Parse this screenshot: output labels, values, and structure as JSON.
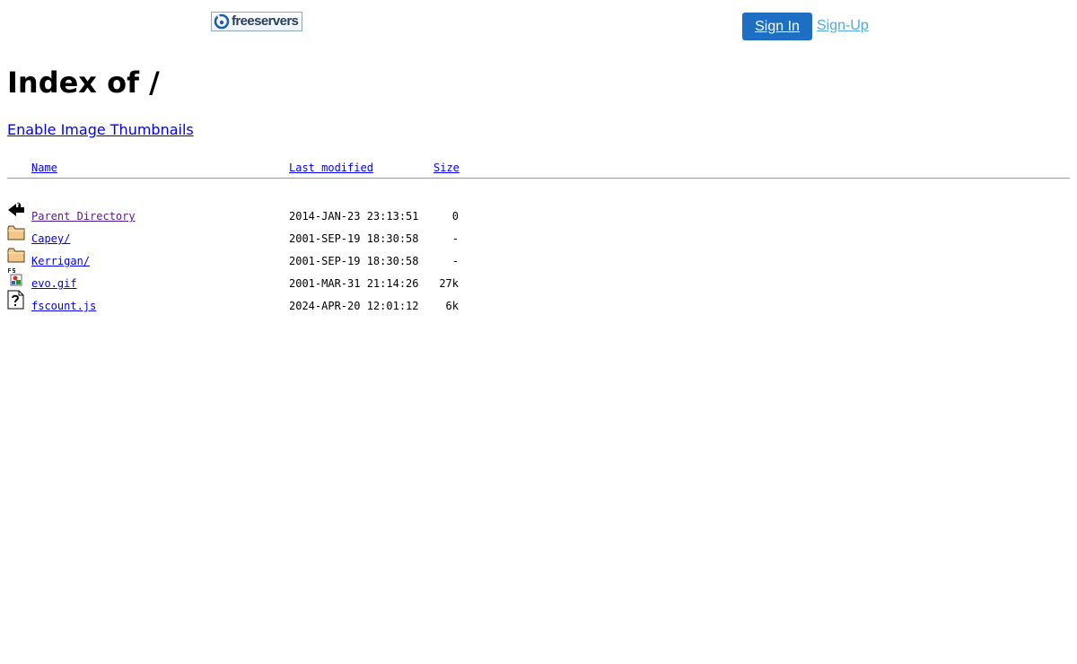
{
  "header": {
    "logo_text": "freeservers",
    "sign_in_label": "Sign In",
    "sign_up_label": "Sign-Up"
  },
  "page": {
    "title": "Index of /",
    "thumbnail_link": "Enable Image Thumbnails"
  },
  "columns": {
    "name": "Name",
    "last_modified": "Last modified",
    "size": "Size"
  },
  "entries": [
    {
      "icon": "back-arrow-icon",
      "name": "Parent Directory",
      "modified": "2014-JAN-23 23:13:51",
      "size": "0"
    },
    {
      "icon": "folder-icon",
      "name": "Capey/",
      "modified": "2001-SEP-19 18:30:58",
      "size": "-"
    },
    {
      "icon": "folder-icon",
      "name": "Kerrigan/",
      "modified": "2001-SEP-19 18:30:58",
      "size": "-"
    },
    {
      "icon": "image-file-icon",
      "name": "evo.gif",
      "modified": "2001-MAR-31 21:14:26",
      "size": "27k"
    },
    {
      "icon": "unknown-file-icon",
      "name": "fscount.js",
      "modified": "2024-APR-20 12:01:12",
      "size": "6k"
    }
  ]
}
